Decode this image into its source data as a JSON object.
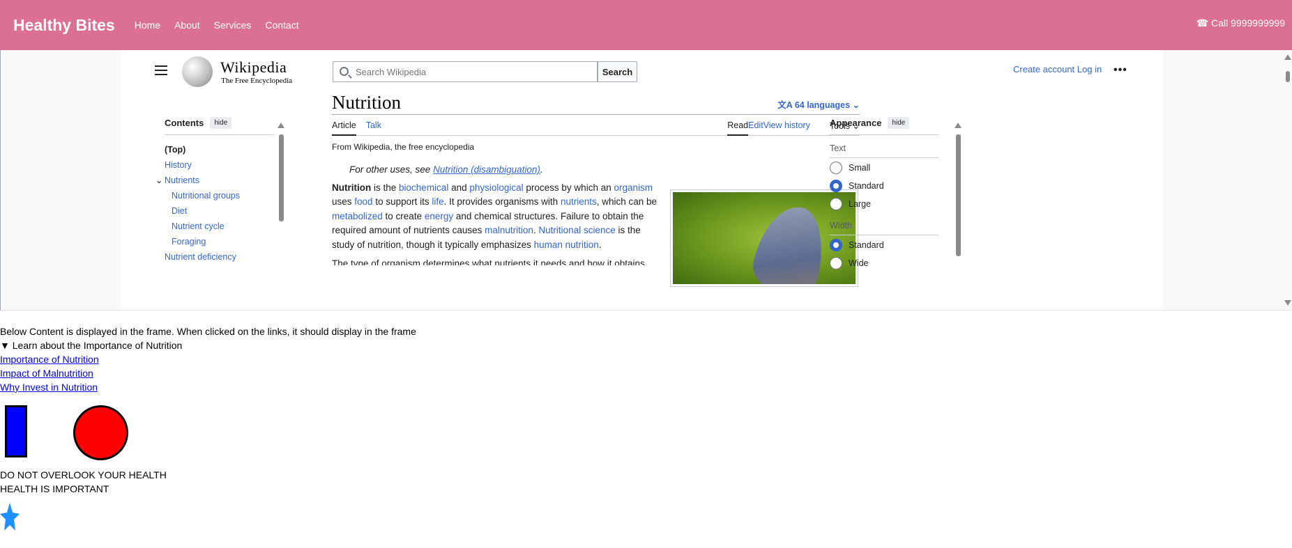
{
  "site": {
    "brand": "Healthy Bites",
    "nav": [
      "Home",
      "About",
      "Services",
      "Contact"
    ],
    "call": "☎ Call 9999999999"
  },
  "wiki": {
    "wordmark": "Wikipedia",
    "tagline": "The Free Encyclopedia",
    "search_placeholder": "Search Wikipedia",
    "search_button": "Search",
    "create_account": "Create account",
    "login": "Log in",
    "more": "•••",
    "toc": {
      "title": "Contents",
      "hide": "hide",
      "items": [
        {
          "label": "(Top)",
          "kind": "top"
        },
        {
          "label": "History",
          "kind": "item"
        },
        {
          "label": "Nutrients",
          "kind": "item",
          "expanded": true
        },
        {
          "label": "Nutritional groups",
          "kind": "sub"
        },
        {
          "label": "Diet",
          "kind": "sub"
        },
        {
          "label": "Nutrient cycle",
          "kind": "sub"
        },
        {
          "label": "Foraging",
          "kind": "sub"
        },
        {
          "label": "Nutrient deficiency",
          "kind": "item"
        }
      ]
    },
    "article": {
      "title": "Nutrition",
      "languages": "64 languages",
      "tabs_left": [
        "Article",
        "Talk"
      ],
      "tabs_right": [
        "Read",
        "Edit",
        "View history",
        "Tools"
      ],
      "from": "From Wikipedia, the free encyclopedia",
      "hatnote_prefix": "For other uses, see ",
      "hatnote_link": "Nutrition (disambiguation)",
      "hatnote_suffix": ".",
      "lead_parts": [
        {
          "t": "Nutrition",
          "b": true
        },
        {
          "t": " is the "
        },
        {
          "t": "biochemical",
          "l": true
        },
        {
          "t": " and "
        },
        {
          "t": "physiological",
          "l": true
        },
        {
          "t": " process by which an "
        },
        {
          "t": "organism",
          "l": true
        },
        {
          "t": " uses "
        },
        {
          "t": "food",
          "l": true
        },
        {
          "t": " to support its "
        },
        {
          "t": "life",
          "l": true
        },
        {
          "t": ". It provides organisms with "
        },
        {
          "t": "nutrients",
          "l": true
        },
        {
          "t": ", which can be "
        },
        {
          "t": "metabolized",
          "l": true
        },
        {
          "t": " to create "
        },
        {
          "t": "energy",
          "l": true
        },
        {
          "t": " and chemical structures. Failure to obtain the required amount of nutrients causes "
        },
        {
          "t": "malnutrition",
          "l": true
        },
        {
          "t": ". "
        },
        {
          "t": "Nutritional science",
          "l": true
        },
        {
          "t": " is the study of nutrition, though it typically emphasizes "
        },
        {
          "t": "human nutrition",
          "l": true
        },
        {
          "t": "."
        }
      ],
      "cut_line": "The type of organism determines what nutrients it needs and how it obtains them."
    },
    "appearance": {
      "title": "Appearance",
      "hide": "hide",
      "text_label": "Text",
      "text_options": [
        {
          "label": "Small",
          "selected": false
        },
        {
          "label": "Standard",
          "selected": true
        },
        {
          "label": "Large",
          "selected": false
        }
      ],
      "width_label": "Width",
      "width_options": [
        {
          "label": "Standard",
          "selected": true
        },
        {
          "label": "Wide",
          "selected": false
        }
      ]
    }
  },
  "below": {
    "note": "Below Content is displayed in the frame. When clicked on the links, it should display in the frame",
    "summary": "▼ Learn about the Importance of Nutrition",
    "links": [
      "Importance of Nutrition",
      "Impact of Malnutrition",
      "Why Invest in Nutrition"
    ],
    "line1": "DO NOT OVERLOOK YOUR HEALTH",
    "line2": "HEALTH IS IMPORTANT",
    "colors": {
      "rect": "#0000ff",
      "circle": "#ff0000",
      "star": "#1e90ff"
    }
  }
}
